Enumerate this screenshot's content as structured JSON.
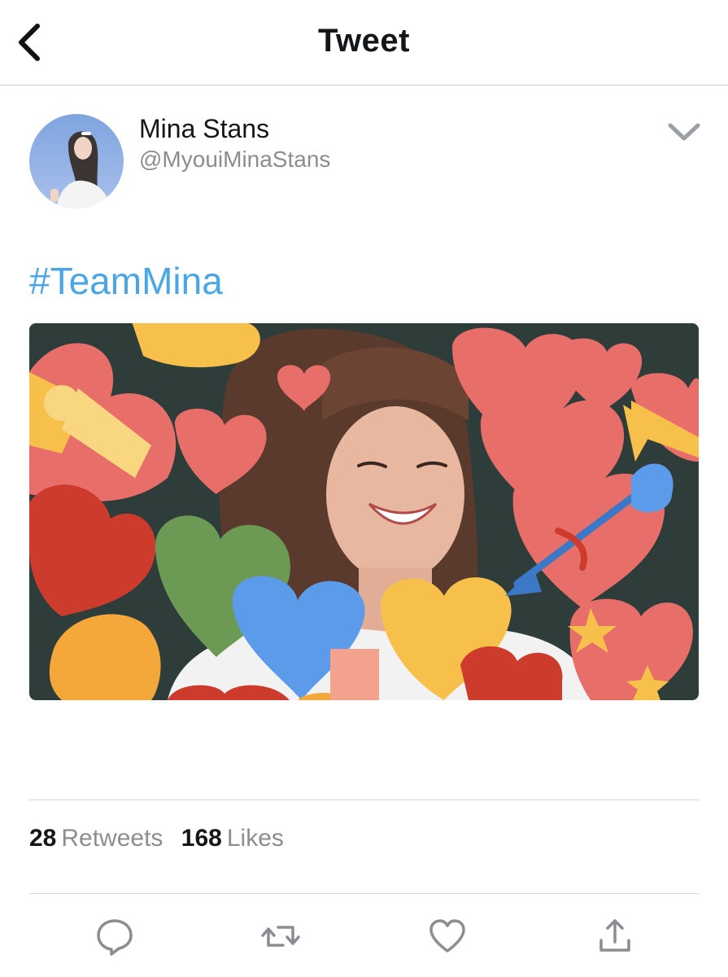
{
  "nav": {
    "title": "Tweet",
    "back_icon": "chevron-left-icon"
  },
  "tweet": {
    "author": {
      "display_name": "Mina Stans",
      "handle": "@MyouiMinaStans",
      "avatar": "profile-photo"
    },
    "text": "#TeamMina",
    "media": "photo of a smiling girl surrounded by colorful heart stickers",
    "menu_icon": "chevron-down-icon"
  },
  "stats": {
    "retweets_count": "28",
    "retweets_label": "Retweets",
    "likes_count": "168",
    "likes_label": "Likes"
  },
  "actions": {
    "reply_icon": "reply-icon",
    "retweet_icon": "retweet-icon",
    "like_icon": "heart-icon",
    "share_icon": "share-icon"
  },
  "colors": {
    "hashtag": "#4aa6e4",
    "secondary_text": "#8a8d91",
    "primary_text": "#14171a",
    "divider": "#d6d6d6",
    "icon": "#8a8d91"
  }
}
